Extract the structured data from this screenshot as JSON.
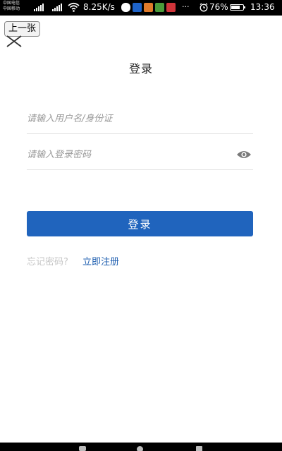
{
  "status_bar": {
    "carrier_1": "中国电信",
    "carrier_2": "中国移动",
    "net_speed": "8.25K/s",
    "more": "···",
    "battery_percent": "76%",
    "battery_level": 0.76,
    "time": "13:36",
    "app_icon_colors": [
      "#3aa0e0",
      "#1e63c8",
      "#e07a2a",
      "#4a9a3a",
      "#d0343a"
    ]
  },
  "toolbar": {
    "prev_label": "上一张"
  },
  "header": {
    "title": "登录"
  },
  "form": {
    "username_placeholder": "请输入用户名/身份证",
    "password_placeholder": "请输入登录密码",
    "login_label": "登录",
    "forgot_label": "忘记密码?",
    "register_label": "立即注册"
  },
  "colors": {
    "primary": "#2064bd",
    "link": "#1f5fb0",
    "muted": "#c6c6c6"
  }
}
